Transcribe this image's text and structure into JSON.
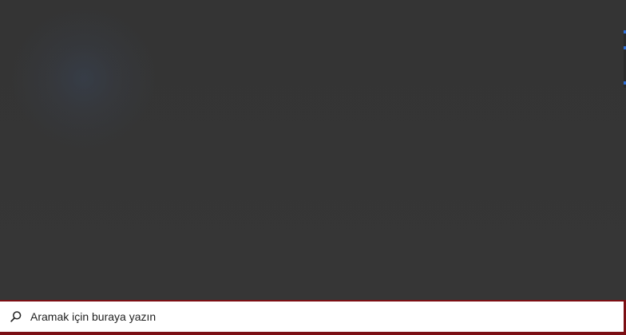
{
  "taskbar": {
    "search": {
      "placeholder": "Aramak için buraya yazın",
      "icon": "search-icon"
    }
  },
  "colors": {
    "desktop_background": "#353535",
    "search_border": "#7b0f14",
    "search_background": "#ffffff",
    "edge_accent": "#2f6fd6"
  }
}
